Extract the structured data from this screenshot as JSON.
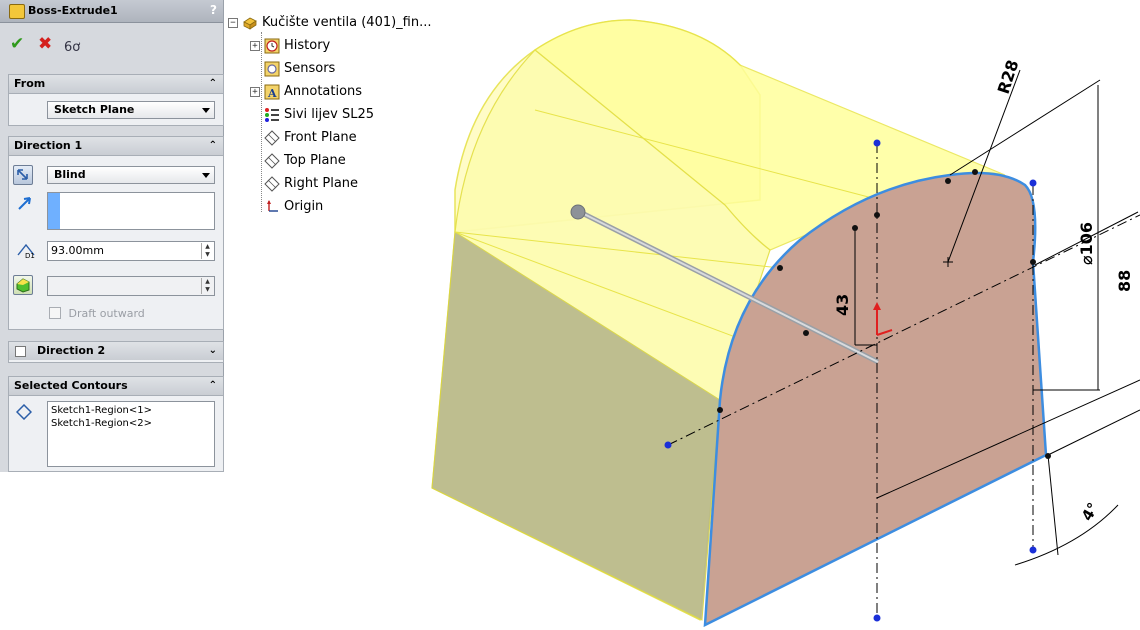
{
  "property_manager": {
    "title": "Boss-Extrude1",
    "help_glyph": "?",
    "actions": {
      "ok_glyph": "✔",
      "cancel_glyph": "✖",
      "detail_glyph": "6ơ"
    },
    "from": {
      "header": "From",
      "selected": "Sketch Plane"
    },
    "direction1": {
      "header": "Direction 1",
      "end_condition": "Blind",
      "depth": "93.00mm",
      "draft_label": "Draft outward"
    },
    "direction2": {
      "header": "Direction 2"
    },
    "selected_contours": {
      "header": "Selected Contours",
      "items": [
        "Sketch1-Region<1>",
        "Sketch1-Region<2>"
      ]
    },
    "chev_up": "«",
    "chev_down": "»"
  },
  "feature_tree": {
    "root": "Kučište ventila (401)_fin...",
    "items": [
      {
        "label": "History",
        "icon": "history-icon",
        "expandable": true
      },
      {
        "label": "Sensors",
        "icon": "sensors-icon",
        "expandable": false
      },
      {
        "label": "Annotations",
        "icon": "annotations-icon",
        "expandable": true
      },
      {
        "label": "Sivi lijev SL25",
        "icon": "material-icon",
        "expandable": false
      },
      {
        "label": "Front Plane",
        "icon": "plane-icon",
        "expandable": false
      },
      {
        "label": "Top Plane",
        "icon": "plane-icon",
        "expandable": false
      },
      {
        "label": "Right Plane",
        "icon": "plane-icon",
        "expandable": false
      },
      {
        "label": "Origin",
        "icon": "origin-icon",
        "expandable": false
      }
    ]
  },
  "viewport": {
    "dimensions": {
      "radius": "R28",
      "diameter": "⌀106",
      "height": "43",
      "width": "88",
      "angle": "4°"
    }
  },
  "colors": {
    "preview_yellow": "#ffff9c",
    "face_brown": "#c9a293",
    "edge_blue": "#3d8de0"
  }
}
